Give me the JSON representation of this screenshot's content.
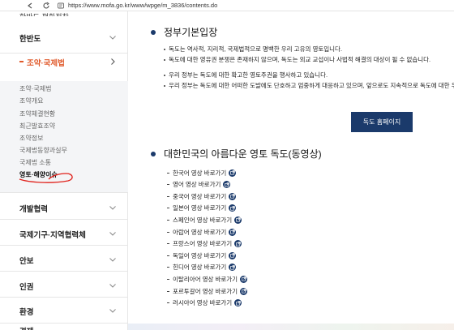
{
  "browser": {
    "url": "https://www.mofa.go.kr/www/wpge/m_3836/contents.do"
  },
  "sidebar": {
    "top_cut_label": "한반도 평화정착",
    "sections_top": [
      {
        "label": "한반도",
        "expanded": false
      },
      {
        "label": "조약·국제법",
        "expanded": true
      }
    ],
    "submenu": [
      {
        "label": "조약·국제법",
        "current": false
      },
      {
        "label": "조약개요",
        "current": false
      },
      {
        "label": "조약체결현황",
        "current": false
      },
      {
        "label": "최근발효조약",
        "current": false
      },
      {
        "label": "조약정보",
        "current": false
      },
      {
        "label": "국제법동향과실무",
        "current": false
      },
      {
        "label": "국제법 소통",
        "current": false
      },
      {
        "label": "영토·해양이슈",
        "current": true
      }
    ],
    "sections_bottom": [
      {
        "label": "개발협력"
      },
      {
        "label": "국제기구·지역협력체"
      },
      {
        "label": "안보"
      },
      {
        "label": "인권"
      },
      {
        "label": "환경"
      },
      {
        "label": "경제"
      }
    ]
  },
  "main": {
    "section1": {
      "title": "정부기본입장",
      "paragraphs": [
        "독도는 역사적, 지리적, 국제법적으로 명백한 우리 고유의 영토입니다.",
        "독도에 대한 영유권 분쟁은 존재하지 않으며, 독도는 외교 교섭이나 사법적 해결의 대상이 될 수 없습니다.",
        "우리 정부는 독도에 대한 확고한 영토주권을 행사하고 있습니다.",
        "우리 정부는 독도에 대한 어떠한 도발에도 단호하고 엄중하게 대응하고 있으며, 앞으로도 지속적으로 독도에 대한 우리의"
      ],
      "button_label": "독도 홈페이지"
    },
    "section2": {
      "title": "대한민국의 아름다운 영토 독도(동영상)",
      "links": [
        "한국어 영상 바로가기",
        "영어 영상 바로가기",
        "중국어 영상 바로가기",
        "일본어 영상 바로가기",
        "스페인어 영상 바로가기",
        "아랍어 영상 바로가기",
        "프랑스어 영상 바로가기",
        "독일어 영상 바로가기",
        "힌디어 영상 바로가기",
        "이탈리아어 영상 바로가기",
        "포르투갈어 영상 바로가기",
        "러시아어 영상 바로가기"
      ]
    }
  },
  "colors": {
    "accent_navy": "#1b3a6b",
    "active_orange": "#e05a2b",
    "annotation_red": "#e0201a"
  }
}
